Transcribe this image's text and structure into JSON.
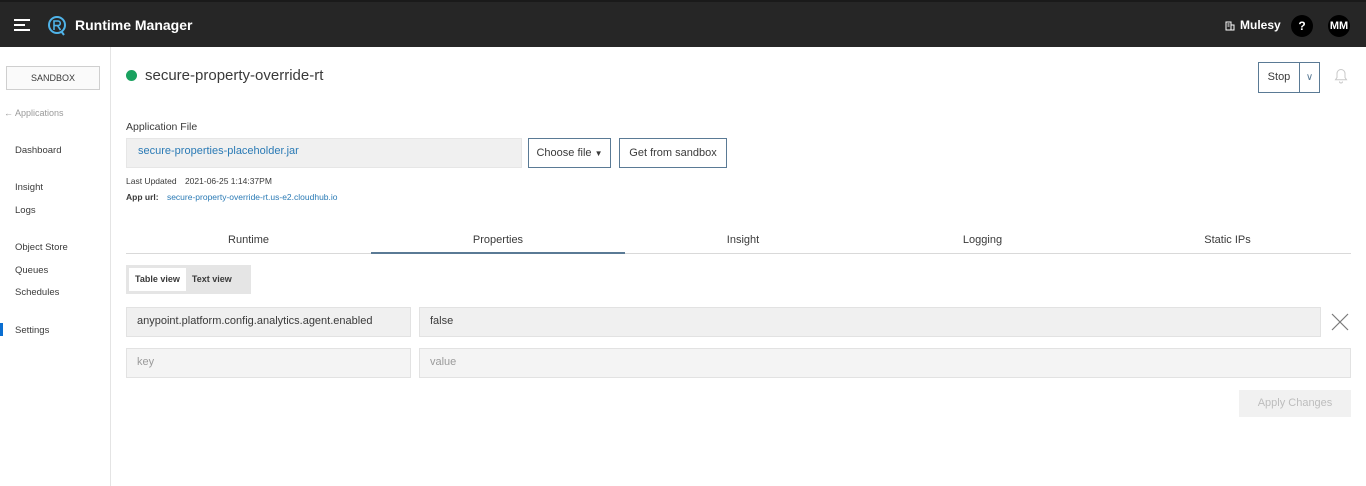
{
  "header": {
    "app_title": "Runtime Manager",
    "user_name": "Mulesy",
    "help_label": "?",
    "avatar_initials": "MM"
  },
  "sidebar": {
    "environment": "SANDBOX",
    "back_label": "Applications",
    "items": [
      {
        "label": "Dashboard",
        "active": false
      },
      {
        "label": "Insight",
        "active": false
      },
      {
        "label": "Logs",
        "active": false
      },
      {
        "label": "Object Store",
        "active": false
      },
      {
        "label": "Queues",
        "active": false
      },
      {
        "label": "Schedules",
        "active": false
      },
      {
        "label": "Settings",
        "active": true
      }
    ]
  },
  "app": {
    "name": "secure-property-override-rt",
    "status_color": "#1aa260",
    "stop_label": "Stop"
  },
  "file": {
    "label": "Application File",
    "value": "secure-properties-placeholder.jar",
    "choose_label": "Choose file",
    "sandbox_label": "Get from sandbox",
    "last_updated_key": "Last Updated",
    "last_updated_value": "2021-06-25 1:14:37PM",
    "app_url_key": "App url:",
    "app_url_value": "secure-property-override-rt.us-e2.cloudhub.io"
  },
  "tabs": [
    {
      "label": "Runtime",
      "active": false
    },
    {
      "label": "Properties",
      "active": true
    },
    {
      "label": "Insight",
      "active": false
    },
    {
      "label": "Logging",
      "active": false
    },
    {
      "label": "Static IPs",
      "active": false
    }
  ],
  "view_toggle": {
    "table_label": "Table view",
    "text_label": "Text view",
    "selected": "Table view"
  },
  "properties": {
    "rows": [
      {
        "key": "anypoint.platform.config.analytics.agent.enabled",
        "value": "false"
      }
    ],
    "key_placeholder": "key",
    "value_placeholder": "value",
    "apply_label": "Apply Changes"
  }
}
